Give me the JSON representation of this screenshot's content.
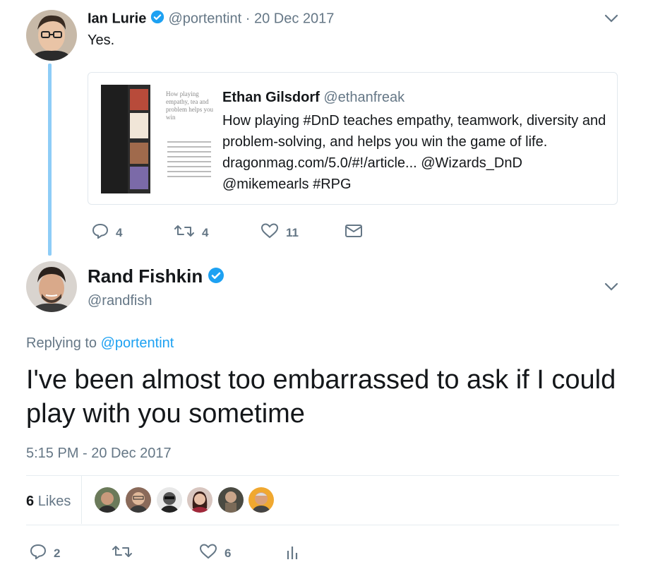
{
  "parent_tweet": {
    "author_name": "Ian Lurie",
    "author_handle": "@portentint",
    "date": "· 20 Dec 2017",
    "text": "Yes.",
    "quoted": {
      "author_name": "Ethan Gilsdorf",
      "author_handle": "@ethanfreak",
      "text": "How playing #DnD teaches empathy, teamwork, diversity and problem-solving, and helps you win the game of life. dragonmag.com/5.0/#!/article... @Wizards_DnD @mikemearls #RPG",
      "thumb_heading": "How playing empathy, tea and problem helps you win"
    },
    "actions": {
      "replies": "4",
      "retweets": "4",
      "likes": "11"
    }
  },
  "main_tweet": {
    "author_name": "Rand Fishkin",
    "author_handle": "@randfish",
    "replying_label": "Replying to",
    "replying_handle": "@portentint",
    "text": "I've been almost too embarrassed to ask if I could play with you sometime",
    "timestamp": "5:15 PM - 20 Dec 2017",
    "likes_count": "6",
    "likes_label": "Likes",
    "actions": {
      "replies": "2",
      "likes": "6"
    }
  },
  "colors": {
    "accent": "#1da1f2",
    "secondary_text": "#657786",
    "like_red": "#e0245e"
  },
  "icons": [
    "verified-badge-icon",
    "chevron-down-icon",
    "reply-icon",
    "retweet-icon",
    "heart-icon",
    "dm-envelope-icon",
    "analytics-icon"
  ]
}
